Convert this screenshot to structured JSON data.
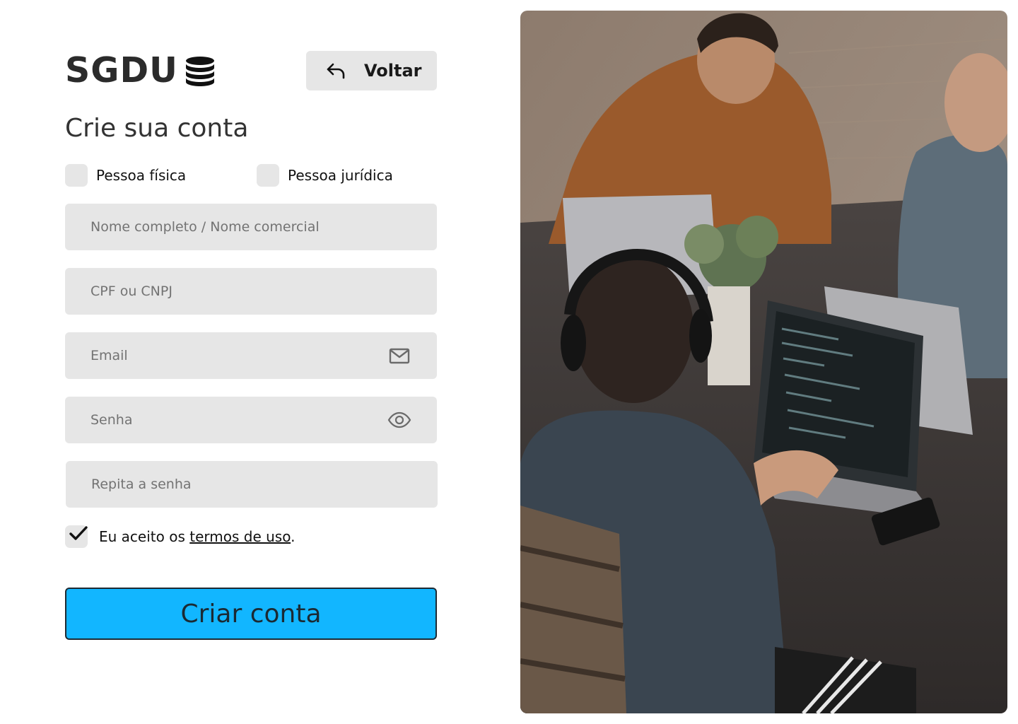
{
  "brand": {
    "title": "SGDU",
    "icon": "database-icon"
  },
  "header": {
    "back_label": "Voltar",
    "back_icon": "undo-arrow-icon"
  },
  "form": {
    "heading": "Crie sua conta",
    "account_types": [
      {
        "label": "Pessoa física",
        "checked": false
      },
      {
        "label": "Pessoa jurídica",
        "checked": false
      }
    ],
    "fields": {
      "name": {
        "placeholder": "Nome completo / Nome comercial",
        "value": ""
      },
      "document": {
        "placeholder": "CPF ou CNPJ",
        "value": ""
      },
      "email": {
        "placeholder": "Email",
        "value": "",
        "icon": "mail-icon"
      },
      "password": {
        "placeholder": "Senha",
        "value": "",
        "icon": "eye-icon"
      },
      "password_repeat": {
        "placeholder": "Repita a senha",
        "value": ""
      }
    },
    "terms": {
      "checked": true,
      "prefix": "Eu aceito os ",
      "link": "termos de uso",
      "suffix": "."
    },
    "submit_label": "Criar conta"
  },
  "colors": {
    "accent": "#12b6ff",
    "field_bg": "#e6e6e6",
    "text": "#111111"
  },
  "photo": {
    "subject": "people working on laptops at a table",
    "icon": "photo-image"
  }
}
